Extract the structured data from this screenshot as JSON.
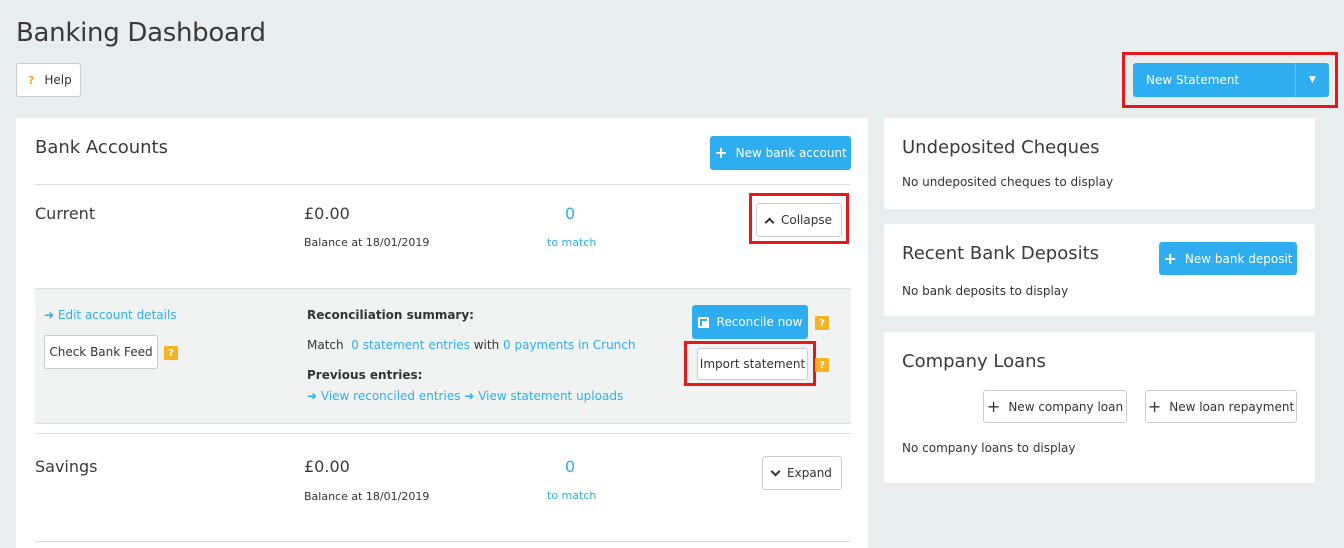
{
  "page": {
    "title": "Banking Dashboard"
  },
  "header": {
    "help_label": "Help",
    "help_icon": "?",
    "new_statement_label": "New Statement",
    "new_statement_caret": "▼"
  },
  "bank_accounts": {
    "title": "Bank Accounts",
    "new_account_label": "New bank account",
    "current": {
      "name": "Current",
      "balance": "£0.00",
      "balance_date": "Balance at 18/01/2019",
      "match_count": "0",
      "match_label": "to match",
      "collapse_label": "Collapse",
      "edit_details": "Edit account details",
      "check_feed": "Check Bank Feed",
      "recon_title": "Reconciliation summary:",
      "match_prefix": "Match",
      "statement_entries": "0 statement entries",
      "with_word": "with",
      "payments": "0 payments in Crunch",
      "previous_title": "Previous entries:",
      "view_reconciled": "View reconciled entries",
      "view_uploads": "View statement uploads",
      "reconcile_now": "Reconcile now",
      "import_statement": "Import statement"
    },
    "savings": {
      "name": "Savings",
      "balance": "£0.00",
      "balance_date": "Balance at 18/01/2019",
      "match_count": "0",
      "match_label": "to match",
      "expand_label": "Expand"
    }
  },
  "undeposited": {
    "title": "Undeposited Cheques",
    "empty": "No undeposited cheques to display"
  },
  "deposits": {
    "title": "Recent Bank Deposits",
    "new_label": "New bank deposit",
    "empty": "No bank deposits to display"
  },
  "loans": {
    "title": "Company Loans",
    "new_loan_label": "New company loan",
    "new_repayment_label": "New loan repayment",
    "empty": "No company loans to display"
  },
  "colors": {
    "accent": "#2eaef0",
    "highlight": "#e3191c",
    "badge": "#f5b423"
  }
}
